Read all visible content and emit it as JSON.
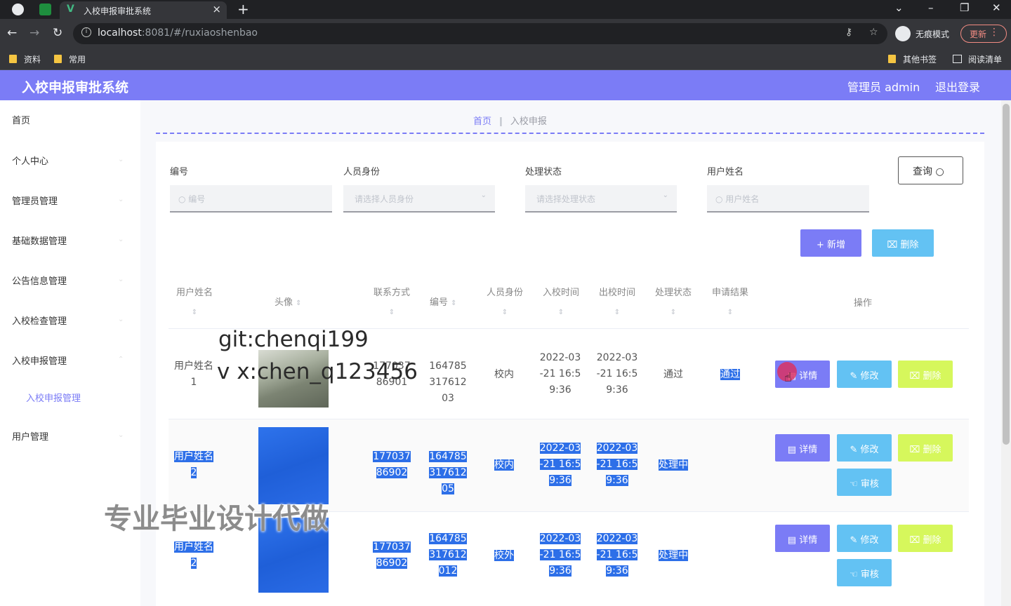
{
  "browser": {
    "tab_title": "入校申报审批系统",
    "tab_favicon": "V",
    "url_host": "localhost",
    "url_path": ":8081/#/ruxiaoshenbao",
    "incognito_label": "无痕模式",
    "update_label": "更新",
    "bookmarks": [
      "资料",
      "常用"
    ],
    "bookmarks_right": [
      "其他书签",
      "阅读清单"
    ]
  },
  "header": {
    "title": "入校申报审批系统",
    "user_label": "管理员 admin",
    "logout_label": "退出登录",
    "accent_color": "#7b7cf6"
  },
  "sidebar": {
    "items": [
      {
        "label": "首页"
      },
      {
        "label": "个人中心"
      },
      {
        "label": "管理员管理"
      },
      {
        "label": "基础数据管理"
      },
      {
        "label": "公告信息管理"
      },
      {
        "label": "入校检查管理"
      },
      {
        "label": "入校申报管理"
      },
      {
        "label": "用户管理"
      }
    ],
    "sub_active": "入校申报管理"
  },
  "breadcrumb": {
    "home": "首页",
    "current": "入校申报"
  },
  "search": {
    "fields": [
      {
        "label": "编号",
        "placeholder": "编号",
        "icon": "search-icon"
      },
      {
        "label": "人员身份",
        "placeholder": "请选择人员身份",
        "icon": "chevron-down-icon"
      },
      {
        "label": "处理状态",
        "placeholder": "请选择处理状态",
        "icon": "chevron-down-icon"
      },
      {
        "label": "用户姓名",
        "placeholder": "用户姓名",
        "icon": "search-icon"
      }
    ],
    "query_label": "查询",
    "add_label": "新增",
    "delete_label": "删除"
  },
  "table": {
    "headers": [
      "用户姓名",
      "头像",
      "联系方式",
      "编号",
      "人员身份",
      "入校时间",
      "出校时间",
      "处理状态",
      "申请结果",
      "操作"
    ],
    "rows": [
      {
        "name": "用户姓名1",
        "phone": "17703786901",
        "code": "16478531761203",
        "identity": "校内",
        "enter_time": "2022-03-21 16:59:36",
        "leave_time": "2022-03-21 16:59:36",
        "status": "通过",
        "result": "通过"
      },
      {
        "name": "用户姓名2",
        "phone": "17703786902",
        "code": "16478531761205",
        "identity": "校内",
        "enter_time": "2022-03-21 16:59:36",
        "leave_time": "2022-03-21 16:59:36",
        "status": "处理中",
        "result": ""
      },
      {
        "name": "用户姓名2",
        "phone": "17703786902",
        "code": "164785317612012",
        "identity": "校外",
        "enter_time": "2022-03-21 16:59:36",
        "leave_time": "2022-03-21 16:59:36",
        "status": "处理中",
        "result": ""
      }
    ],
    "actions": {
      "detail": "详情",
      "edit": "修改",
      "delete": "删除",
      "audit": "审核"
    }
  },
  "watermarks": {
    "line1": "git:chenqi199",
    "line2": "v x:chen_q123456",
    "line3": "专业毕业设计代做"
  }
}
